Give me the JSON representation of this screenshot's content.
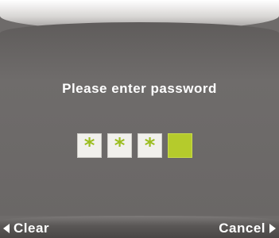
{
  "dialog": {
    "prompt": "Please enter password"
  },
  "password": {
    "mask_char": "*",
    "entered_count": 3,
    "total_digits": 4
  },
  "softkeys": {
    "left_label": "Clear",
    "right_label": "Cancel"
  },
  "colors": {
    "background": "#6e6b6a",
    "accent": "#b5cb2c",
    "mask_char": "#9bbd1f",
    "text": "#ffffff"
  },
  "icons": {
    "left_softkey": "triangle-left-icon",
    "right_softkey": "triangle-right-icon"
  }
}
